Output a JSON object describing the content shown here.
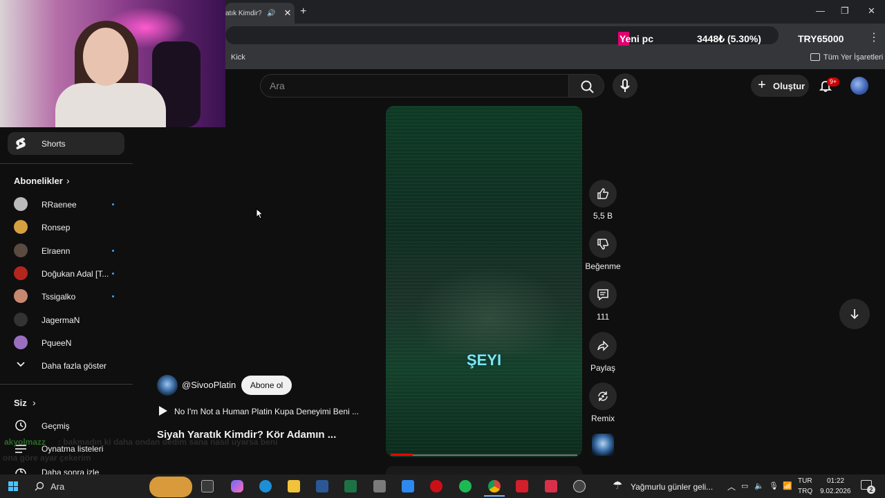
{
  "browser": {
    "tab_title": "atık Kimdir? ",
    "bookmark_kick": "Kick",
    "bookmark_all": "Tüm Yer İşaretleri"
  },
  "ticker": {
    "label": "Yeni pc",
    "amount": "3448₺ (5.30%)",
    "goal": "TRY65000"
  },
  "header": {
    "search_placeholder": "Ara",
    "create_label": "Oluştur",
    "notif_badge": "9+"
  },
  "sidebar": {
    "shorts_label": "Shorts",
    "subscriptions_title": "Abonelikler",
    "subscriptions": [
      {
        "name": "RRaenee",
        "live": true,
        "color": "#bbbbbb"
      },
      {
        "name": "Ronsep",
        "live": false,
        "color": "#d4a040"
      },
      {
        "name": "Elraenn",
        "live": true,
        "color": "#5a4a40"
      },
      {
        "name": "Doğukan Adal [T...",
        "live": true,
        "color": "#b3261e"
      },
      {
        "name": "Tssigalko",
        "live": true,
        "color": "#c88870"
      },
      {
        "name": "JagermaN",
        "live": false,
        "color": "#333333"
      },
      {
        "name": "PqueeN",
        "live": false,
        "color": "#9a6fbf"
      }
    ],
    "show_more": "Daha fazla göster",
    "you_title": "Siz",
    "history": "Geçmiş",
    "playlists": "Oynatma listeleri",
    "watch_later": "Daha sonra izle"
  },
  "video": {
    "caption": "ŞEYI",
    "progress": 0.12,
    "channel_handle": "@SivooPlatin",
    "subscribe_label": "Abone ol",
    "music": "No I'm Not a Human Platin Kupa Deneyimi Beni ...",
    "title": "Siyah Yaratık Kimdir? Kör Adamın ..."
  },
  "actions": {
    "likes": "5,5 B",
    "dislike_label": "Beğenme",
    "comments": "111",
    "share_label": "Paylaş",
    "remix_label": "Remix"
  },
  "chat": {
    "user": "akyolmazz",
    "line1": ": bakmadın ki daha ondan dedim sana nasıl uyarsa beni",
    "line2": "ona göre ayar çekerim"
  },
  "taskbar": {
    "search_label": "Ara",
    "weather": "Yağmurlu günler geli...",
    "lang_top": "TUR",
    "lang_bottom": "TRQ",
    "time": "01:22",
    "date": "9.02.2026",
    "notif_count": "2"
  }
}
